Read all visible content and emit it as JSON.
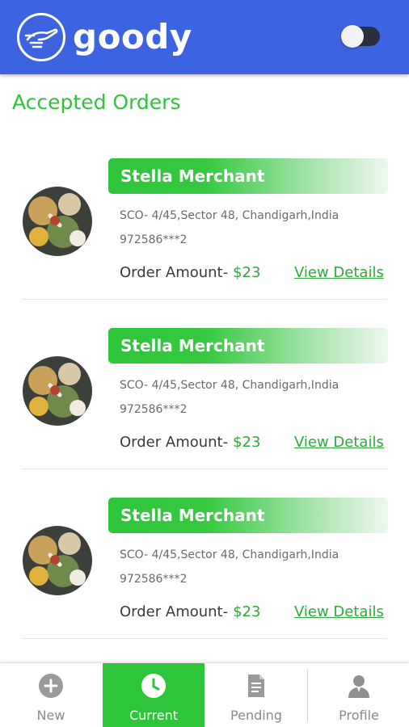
{
  "app": {
    "name": "goody",
    "logo_icon": "hand-logo-icon",
    "dark_mode_toggle": {
      "icon": "toggle-switch-icon",
      "on": false
    }
  },
  "page": {
    "title": "Accepted Orders"
  },
  "orders": [
    {
      "merchant": "Stella Merchant",
      "address": "SCO- 4/45,Sector 48, Chandigarh,India",
      "phone": "972586***2",
      "amount_label": "Order Amount-",
      "amount": "$23",
      "details_link": "View Details",
      "image_icon": "food-photo-avatar"
    },
    {
      "merchant": "Stella Merchant",
      "address": "SCO- 4/45,Sector 48, Chandigarh,India",
      "phone": "972586***2",
      "amount_label": "Order Amount-",
      "amount": "$23",
      "details_link": "View Details",
      "image_icon": "food-photo-avatar"
    },
    {
      "merchant": "Stella Merchant",
      "address": "SCO- 4/45,Sector 48, Chandigarh,India",
      "phone": "972586***2",
      "amount_label": "Order Amount-",
      "amount": "$23",
      "details_link": "View Details",
      "image_icon": "food-photo-avatar"
    }
  ],
  "bottom_nav": {
    "items": [
      {
        "label": "New",
        "icon": "plus-circle-icon",
        "active": false
      },
      {
        "label": "Current",
        "icon": "clock-icon",
        "active": true
      },
      {
        "label": "Pending",
        "icon": "document-list-icon",
        "active": false
      },
      {
        "label": "Profile",
        "icon": "user-profile-icon",
        "active": false
      }
    ]
  },
  "colors": {
    "header": "#3d64e0",
    "accent_green": "#2fc53a",
    "amount_green": "#2fa93a",
    "nav_inactive": "#8a8a8a"
  }
}
